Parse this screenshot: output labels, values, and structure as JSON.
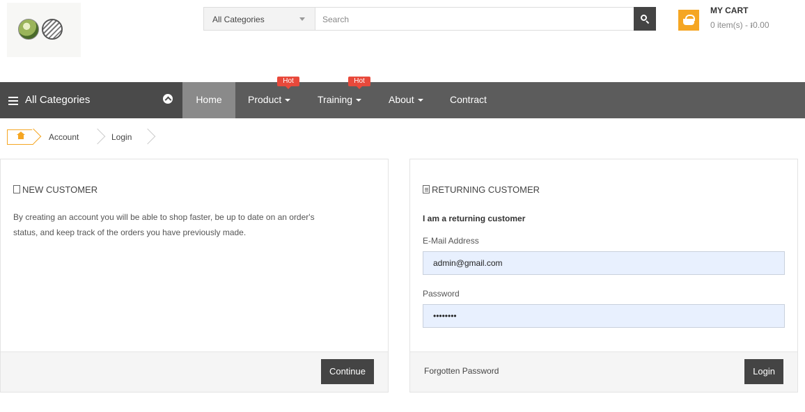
{
  "header": {
    "search": {
      "category": "All Categories",
      "placeholder": "Search"
    },
    "cart": {
      "title": "MY CART",
      "summary": "0 item(s) - ៛0.00"
    }
  },
  "nav": {
    "all_categories": "All Categories",
    "items": [
      {
        "label": "Home",
        "active": true
      },
      {
        "label": "Product",
        "badge": "Hot",
        "dropdown": true
      },
      {
        "label": "Training",
        "badge": "Hot",
        "dropdown": true
      },
      {
        "label": "About",
        "dropdown": true
      },
      {
        "label": "Contract"
      }
    ]
  },
  "breadcrumb": [
    "Account",
    "Login"
  ],
  "new_customer": {
    "title": "NEW CUSTOMER",
    "text_line1": "By creating an account you will be able to shop faster, be up to date on an order's",
    "text_line2": "status, and keep track of the orders you have previously made.",
    "continue": "Continue"
  },
  "returning_customer": {
    "title": "RETURNING CUSTOMER",
    "subtitle": "I am a returning customer",
    "email_label": "E-Mail Address",
    "email_value": "admin@gmail.com",
    "password_label": "Password",
    "password_value": "••••••••",
    "forgotten": "Forgotten Password",
    "login": "Login"
  },
  "colors": {
    "accent": "#f5a623",
    "hot": "#e8493b",
    "nav_bg": "#5c5c5c",
    "autofill": "#e8f0fe"
  }
}
